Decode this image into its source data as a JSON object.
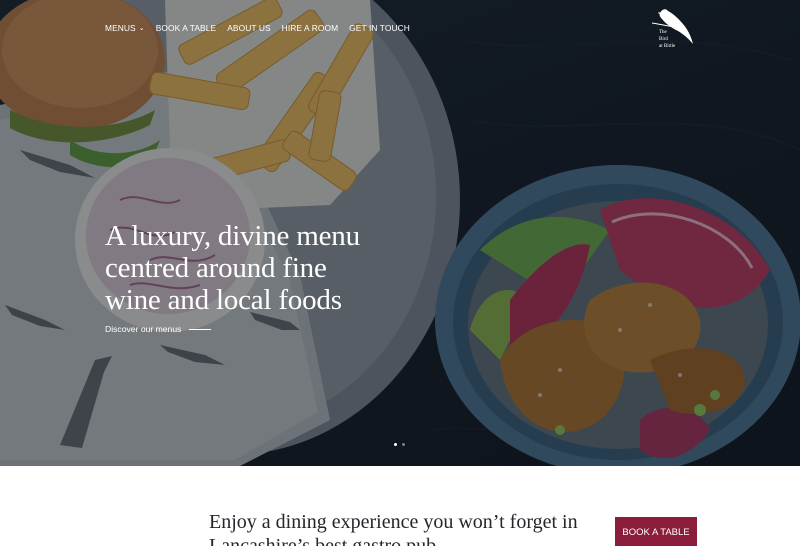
{
  "nav": {
    "items": [
      {
        "label": "MENUS",
        "has_dropdown": true
      },
      {
        "label": "BOOK A TABLE"
      },
      {
        "label": "ABOUT US"
      },
      {
        "label": "HIRE A ROOM"
      },
      {
        "label": "GET IN TOUCH"
      }
    ]
  },
  "logo": {
    "text_lines": [
      "The",
      "Bird",
      "at Birtle"
    ],
    "icon": "bird-icon"
  },
  "hero": {
    "headline_lines": [
      "A luxury, divine menu",
      "centred around fine",
      "wine and local foods"
    ],
    "cta_label": "Discover our menus",
    "slider": {
      "count": 2,
      "active_index": 0
    },
    "paper_print": "The Bird at Birtle"
  },
  "intro": {
    "tagline": "Enjoy a dining experience you won’t forget in Lancashire’s best gastro pub",
    "book_button_label": "BOOK A TABLE"
  },
  "colors": {
    "hero_background": "#141d27",
    "accent": "#8a1d3a",
    "text_dark": "#25262b",
    "nav_text": "#ffffff"
  }
}
